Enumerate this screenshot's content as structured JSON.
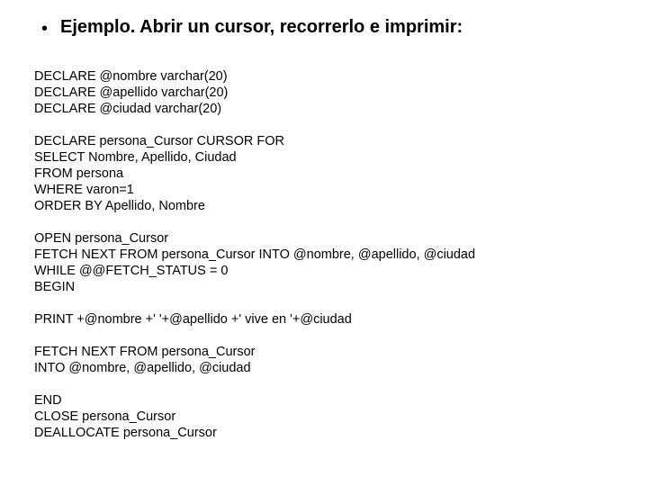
{
  "bullet_glyph": "•",
  "title": "Ejemplo. Abrir un cursor, recorrerlo e imprimir:",
  "code": {
    "l01": "DECLARE @nombre varchar(20)",
    "l02": "DECLARE @apellido varchar(20)",
    "l03": "DECLARE @ciudad varchar(20)",
    "l04": "",
    "l05": "DECLARE persona_Cursor CURSOR FOR",
    "l06": "SELECT Nombre, Apellido, Ciudad",
    "l07": "FROM persona",
    "l08": "WHERE varon=1",
    "l09": "ORDER BY Apellido, Nombre",
    "l10": "",
    "l11": "OPEN persona_Cursor",
    "l12": "FETCH NEXT FROM persona_Cursor INTO @nombre, @apellido, @ciudad",
    "l13": "WHILE @@FETCH_STATUS = 0",
    "l14": "BEGIN",
    "l15": "",
    "l16": "PRINT +@nombre +' '+@apellido +' vive en '+@ciudad",
    "l17": "",
    "l18": "FETCH NEXT FROM persona_Cursor",
    "l19": "INTO @nombre, @apellido, @ciudad",
    "l20": "",
    "l21": "END",
    "l22": "CLOSE persona_Cursor",
    "l23": "DEALLOCATE persona_Cursor"
  }
}
